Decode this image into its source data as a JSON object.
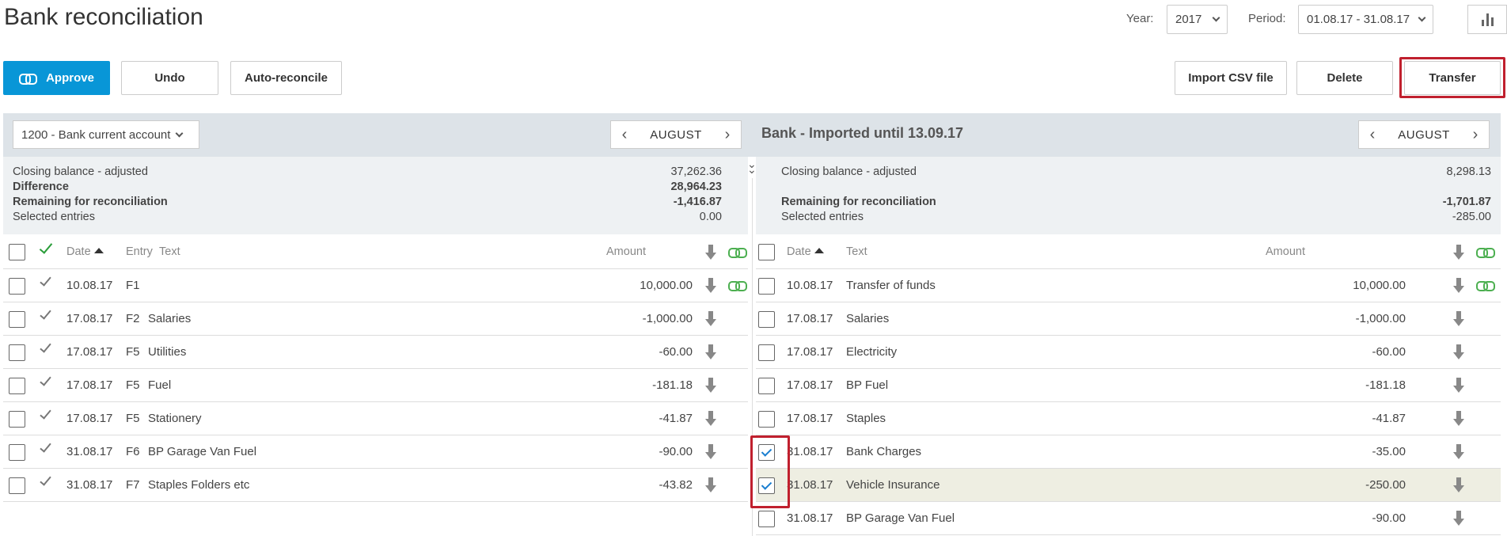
{
  "page": {
    "title": "Bank reconciliation"
  },
  "topbar": {
    "year_label": "Year:",
    "year_value": "2017",
    "period_label": "Period:",
    "period_value": "01.08.17 - 31.08.17",
    "chart_icon": "bar-chart-icon"
  },
  "actions": {
    "approve": "Approve",
    "undo": "Undo",
    "auto_reconcile": "Auto-reconcile",
    "import_csv": "Import CSV file",
    "delete": "Delete",
    "transfer": "Transfer"
  },
  "left": {
    "account": "1200 - Bank current account",
    "month": "AUGUST",
    "summary": {
      "closing_label": "Closing balance - adjusted",
      "closing_value": "37,262.36",
      "difference_label": "Difference",
      "difference_value": "28,964.23",
      "remaining_label": "Remaining for reconciliation",
      "remaining_value": "-1,416.87",
      "selected_label": "Selected entries",
      "selected_value": "0.00"
    },
    "columns": {
      "date": "Date",
      "entry": "Entry",
      "text": "Text",
      "amount": "Amount"
    },
    "rows": [
      {
        "date": "10.08.17",
        "entry": "F1",
        "text": "",
        "amount": "10,000.00",
        "linked": true
      },
      {
        "date": "17.08.17",
        "entry": "F2",
        "text": "Salaries",
        "amount": "-1,000.00",
        "linked": false
      },
      {
        "date": "17.08.17",
        "entry": "F5",
        "text": "Utilities",
        "amount": "-60.00",
        "linked": false
      },
      {
        "date": "17.08.17",
        "entry": "F5",
        "text": "Fuel",
        "amount": "-181.18",
        "linked": false
      },
      {
        "date": "17.08.17",
        "entry": "F5",
        "text": "Stationery",
        "amount": "-41.87",
        "linked": false
      },
      {
        "date": "31.08.17",
        "entry": "F6",
        "text": "BP Garage Van Fuel",
        "amount": "-90.00",
        "linked": false
      },
      {
        "date": "31.08.17",
        "entry": "F7",
        "text": "Staples Folders etc",
        "amount": "-43.82",
        "linked": false
      }
    ]
  },
  "right": {
    "title": "Bank - Imported until 13.09.17",
    "month": "AUGUST",
    "summary": {
      "closing_label": "Closing balance - adjusted",
      "closing_value": "8,298.13",
      "remaining_label": "Remaining for reconciliation",
      "remaining_value": "-1,701.87",
      "selected_label": "Selected entries",
      "selected_value": "-285.00"
    },
    "columns": {
      "date": "Date",
      "text": "Text",
      "amount": "Amount"
    },
    "rows": [
      {
        "date": "10.08.17",
        "text": "Transfer of funds",
        "amount": "10,000.00",
        "checked": false
      },
      {
        "date": "17.08.17",
        "text": "Salaries",
        "amount": "-1,000.00",
        "checked": false
      },
      {
        "date": "17.08.17",
        "text": "Electricity",
        "amount": "-60.00",
        "checked": false
      },
      {
        "date": "17.08.17",
        "text": "BP Fuel",
        "amount": "-181.18",
        "checked": false
      },
      {
        "date": "17.08.17",
        "text": "Staples",
        "amount": "-41.87",
        "checked": false
      },
      {
        "date": "31.08.17",
        "text": "Bank Charges",
        "amount": "-35.00",
        "checked": true
      },
      {
        "date": "31.08.17",
        "text": "Vehicle Insurance",
        "amount": "-250.00",
        "checked": true
      },
      {
        "date": "31.08.17",
        "text": "BP Garage Van Fuel",
        "amount": "-90.00",
        "checked": false
      }
    ]
  },
  "colors": {
    "primary": "#0896d7",
    "highlight": "#c0202e",
    "link_green": "#4caf50"
  }
}
